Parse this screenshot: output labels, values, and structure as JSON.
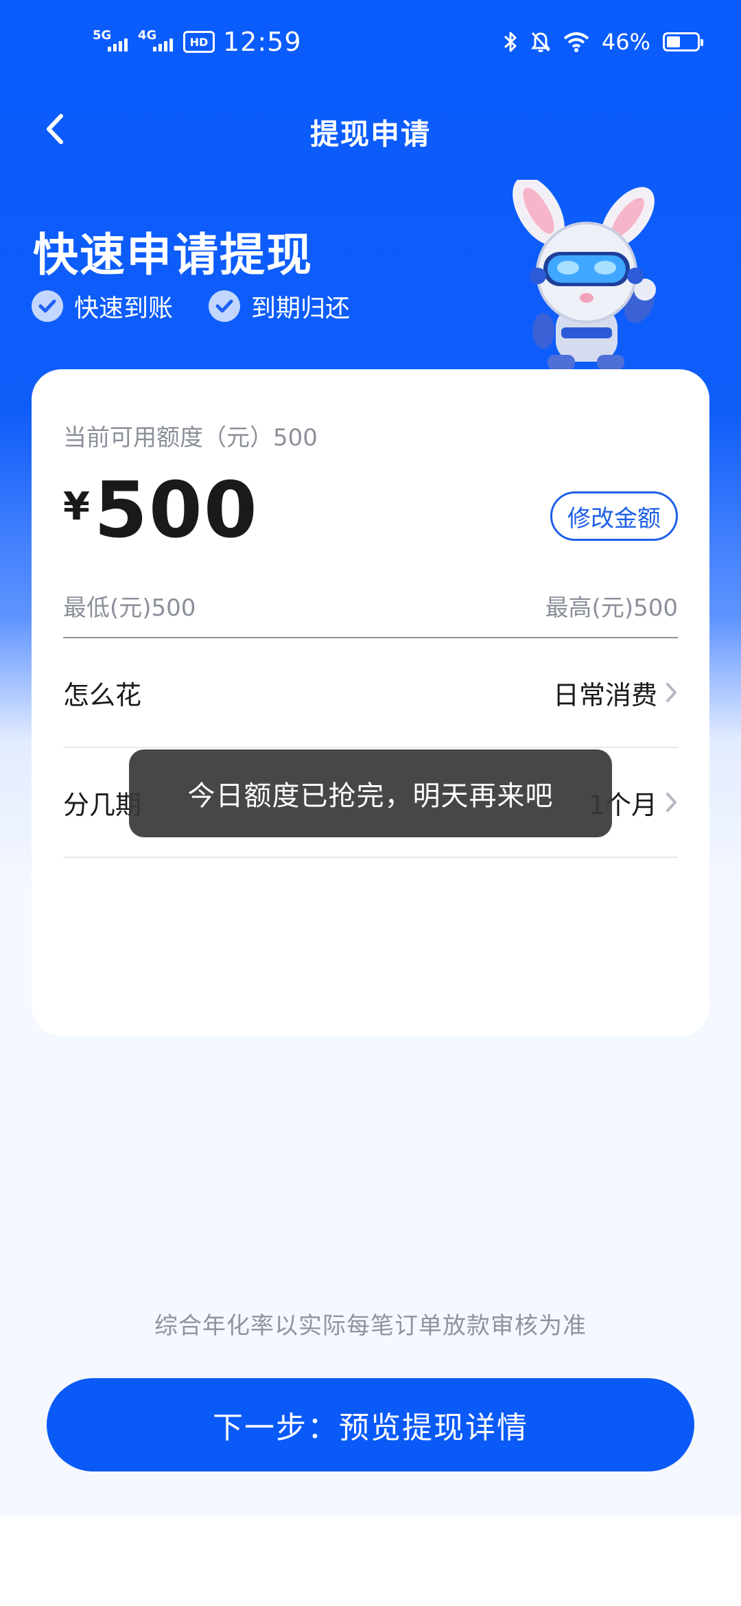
{
  "status_bar": {
    "net1": "5G",
    "net2": "4G",
    "hd": "HD",
    "time": "12:59",
    "battery": "46%",
    "battery_level": 0.46,
    "icons": [
      "bluetooth-icon",
      "bell-off-icon",
      "wifi-icon",
      "battery-icon"
    ]
  },
  "header": {
    "title": "提现申请",
    "back_icon": "chevron-left-icon"
  },
  "hero": {
    "title": "快速申请提现",
    "features": [
      "快速到账",
      "到期归还"
    ]
  },
  "card": {
    "available": "当前可用额度（元）500",
    "currency": "¥",
    "amount": "500",
    "modify_label": "修改金额",
    "min": "最低(元)500",
    "max": "最高(元)500",
    "rows": [
      {
        "label": "怎么花",
        "value": "日常消费"
      },
      {
        "label": "分几期",
        "value": "1个月"
      }
    ]
  },
  "toast": "今日额度已抢完，明天再来吧",
  "footer": {
    "disclaimer": "综合年化率以实际每笔订单放款审核为准",
    "next_label": "下一步：预览提现详情"
  },
  "colors": {
    "primary": "#0a5af8",
    "accent_border": "#1e5fe8",
    "text_dark": "#1a1a1a",
    "text_gray": "#8a8f99"
  }
}
